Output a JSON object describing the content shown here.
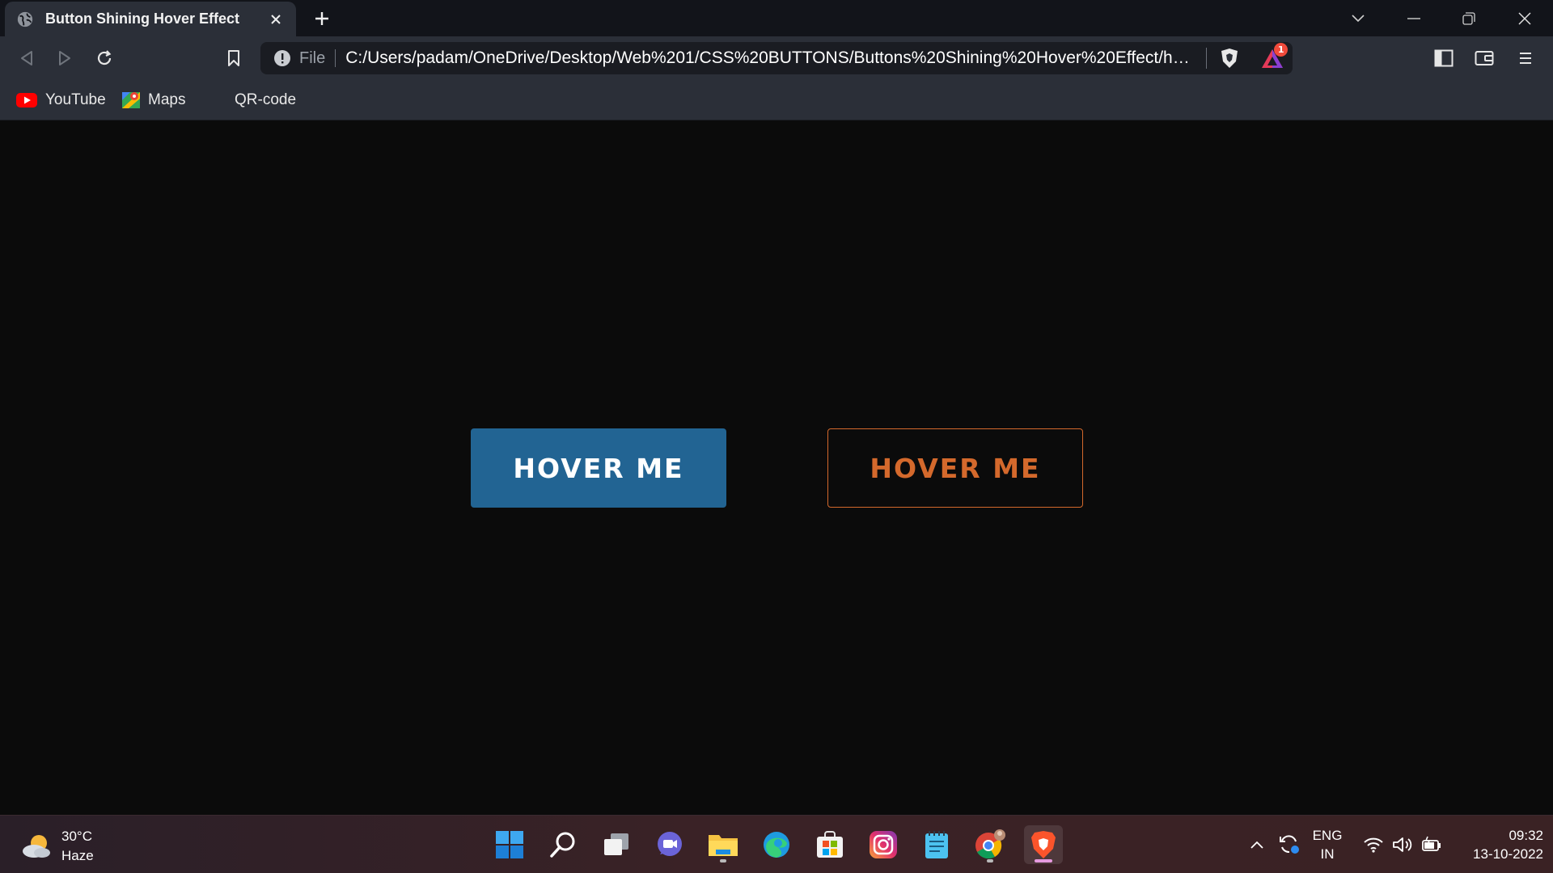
{
  "browser": {
    "tab": {
      "title": "Button Shining Hover Effect"
    },
    "address": {
      "scheme": "File",
      "url": "C:/Users/padam/OneDrive/Desktop/Web%201/CSS%20BUTTONS/Buttons%20Shining%20Hover%20Effect/hom..."
    },
    "rewards_badge": "1",
    "bookmarks": [
      {
        "label": "YouTube",
        "icon": "youtube-icon"
      },
      {
        "label": "Maps",
        "icon": "maps-icon"
      },
      {
        "label": "QR-code",
        "icon": ""
      }
    ]
  },
  "page": {
    "buttons": [
      {
        "label": "HOVER ME",
        "style": "filled",
        "color": "#226493"
      },
      {
        "label": "HOVER ME",
        "style": "outline",
        "color": "#d4692c"
      }
    ]
  },
  "taskbar": {
    "weather": {
      "temp": "30°C",
      "condition": "Haze"
    },
    "language": {
      "line1": "ENG",
      "line2": "IN"
    },
    "clock": {
      "time": "09:32",
      "date": "13-10-2022"
    }
  }
}
